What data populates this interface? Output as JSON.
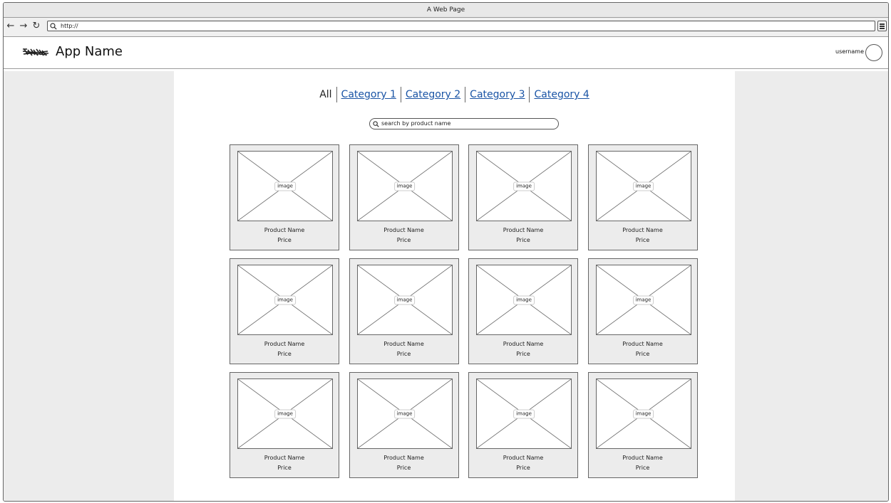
{
  "window": {
    "title": "A Web Page"
  },
  "browser": {
    "url": "http://"
  },
  "app": {
    "name": "App Name",
    "username": "username"
  },
  "categories": [
    {
      "label": "All",
      "active": true
    },
    {
      "label": "Category 1",
      "active": false
    },
    {
      "label": "Category 2",
      "active": false
    },
    {
      "label": "Category 3",
      "active": false
    },
    {
      "label": "Category 4",
      "active": false
    }
  ],
  "search": {
    "placeholder": "search by product name"
  },
  "colors": {
    "link": "#1a54a5",
    "card_bg": "#ececec",
    "page_bg": "#ececec"
  },
  "products": [
    {
      "image": "image",
      "name": "Product Name",
      "price": "Price"
    },
    {
      "image": "image",
      "name": "Product Name",
      "price": "Price"
    },
    {
      "image": "image",
      "name": "Product Name",
      "price": "Price"
    },
    {
      "image": "image",
      "name": "Product Name",
      "price": "Price"
    },
    {
      "image": "image",
      "name": "Product Name",
      "price": "Price"
    },
    {
      "image": "image",
      "name": "Product Name",
      "price": "Price"
    },
    {
      "image": "image",
      "name": "Product Name",
      "price": "Price"
    },
    {
      "image": "image",
      "name": "Product Name",
      "price": "Price"
    },
    {
      "image": "image",
      "name": "Product Name",
      "price": "Price"
    },
    {
      "image": "image",
      "name": "Product Name",
      "price": "Price"
    },
    {
      "image": "image",
      "name": "Product Name",
      "price": "Price"
    },
    {
      "image": "image",
      "name": "Product Name",
      "price": "Price"
    }
  ]
}
